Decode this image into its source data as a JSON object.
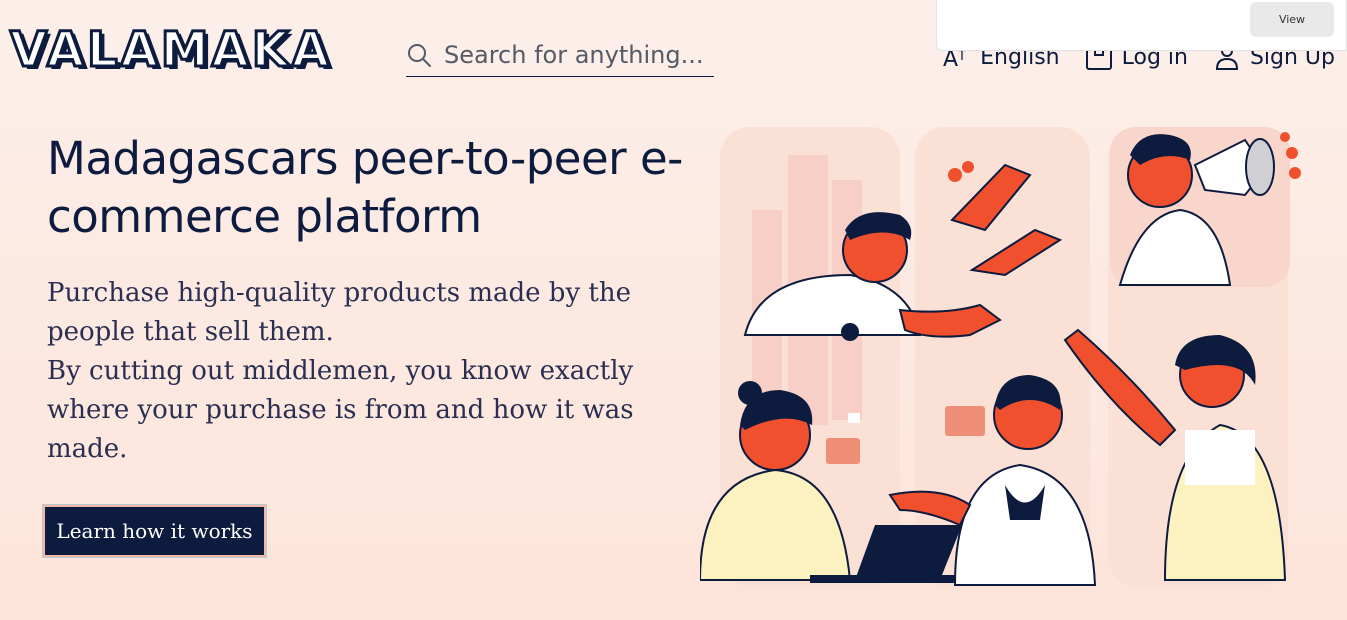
{
  "header": {
    "logo": "VALAMAKA",
    "search_placeholder": "Search for anything...",
    "nav": {
      "language": "English",
      "login": "Log in",
      "signup": "Sign Up"
    }
  },
  "popup": {
    "view_label": "View"
  },
  "hero": {
    "title": "Madagascars peer-to-peer e-commerce platform",
    "paragraph1": "Purchase high-quality products made by the people that sell them.",
    "paragraph2": "By cutting out middlemen, you know exactly where your purchase is from and how it was made.",
    "cta_label": "Learn how it works"
  },
  "colors": {
    "navy": "#0d1b3e",
    "accent": "#f0502d",
    "background": "#fdeae2"
  }
}
